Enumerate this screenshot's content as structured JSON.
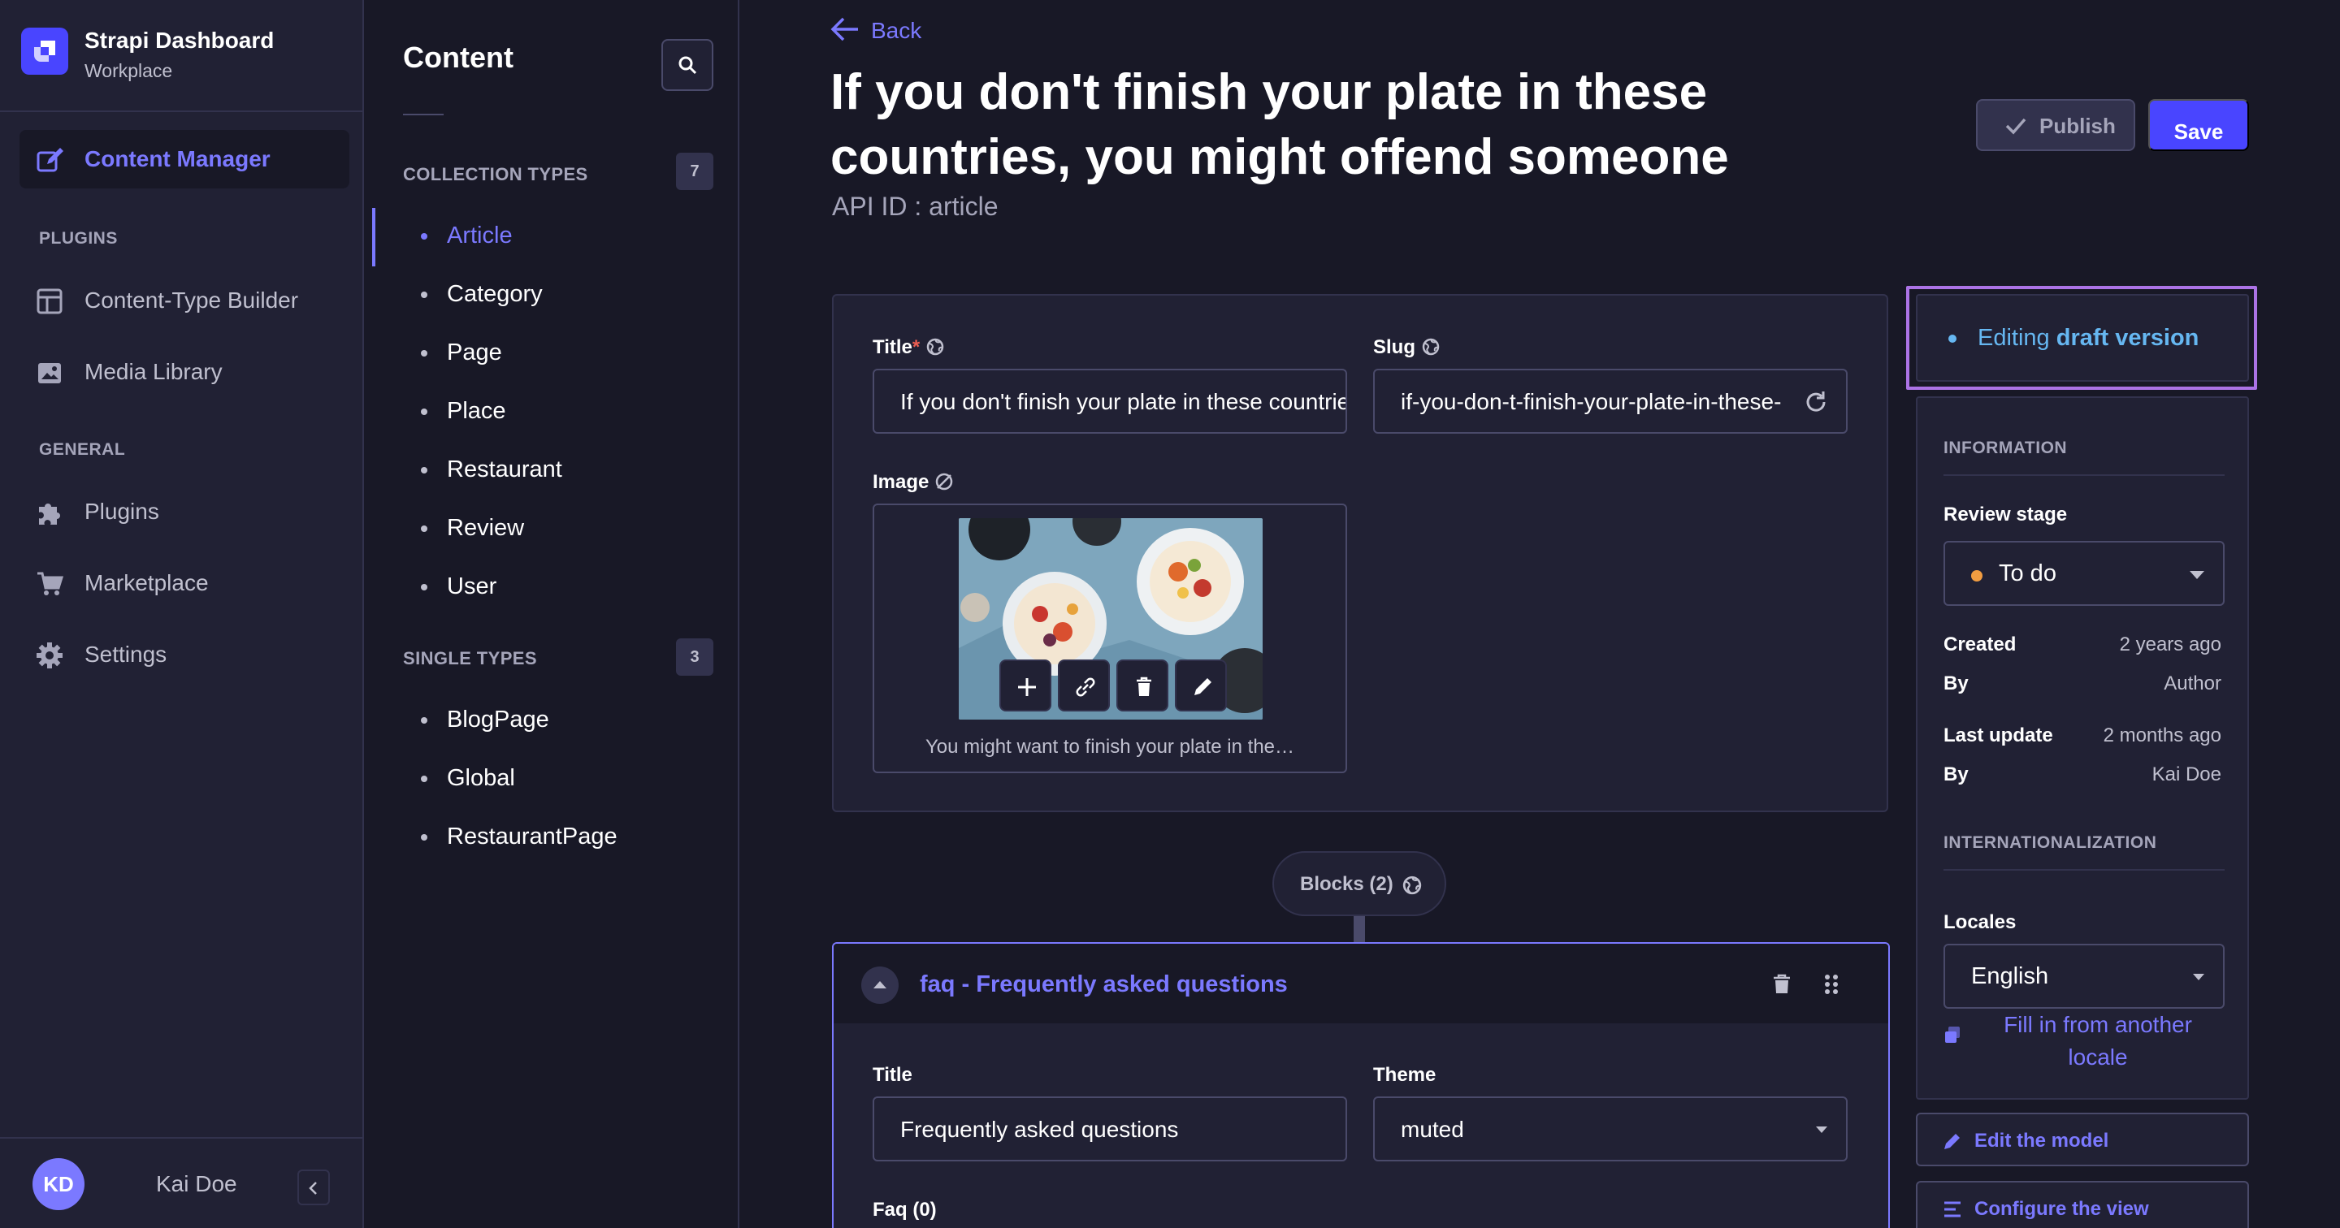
{
  "brand": {
    "title": "Strapi Dashboard",
    "subtitle": "Workplace"
  },
  "nav": {
    "content_manager": "Content Manager",
    "plugins_section": "PLUGINS",
    "plugins_items": [
      "Content-Type Builder",
      "Media Library"
    ],
    "general_section": "GENERAL",
    "general_items": [
      "Plugins",
      "Marketplace",
      "Settings"
    ],
    "user": {
      "initials": "KD",
      "name": "Kai Doe"
    }
  },
  "subnav": {
    "title": "Content",
    "collection_section": "COLLECTION TYPES",
    "collection_count": "7",
    "collection_items": [
      "Article",
      "Category",
      "Page",
      "Place",
      "Restaurant",
      "Review",
      "User"
    ],
    "active_item": "Article",
    "single_section": "SINGLE TYPES",
    "single_count": "3",
    "single_items": [
      "BlogPage",
      "Global",
      "RestaurantPage"
    ]
  },
  "header": {
    "back_label": "Back",
    "title": "If you don't finish your plate in these countries, you might offend someone",
    "api_id": "API ID : article",
    "publish_label": "Publish",
    "save_label": "Save"
  },
  "form": {
    "title_label": "Title",
    "title_required": "*",
    "title_value": "If you don't finish your plate in these countries, you might offend someone",
    "slug_label": "Slug",
    "slug_value": "if-you-don-t-finish-your-plate-in-these-countries-you-might-offend-someone",
    "image_label": "Image",
    "image_caption": "You might want to finish your plate in the…"
  },
  "blocks": {
    "pill_label": "Blocks (2)",
    "faq_title": "faq - Frequently asked questions",
    "faq_title_label": "Title",
    "faq_title_value": "Frequently asked questions",
    "theme_label": "Theme",
    "theme_value": "muted",
    "faq_list_label": "Faq (0)"
  },
  "panel": {
    "draft_prefix": "Editing ",
    "draft_bold": "draft version",
    "information": "INFORMATION",
    "review_stage_label": "Review stage",
    "review_stage_value": "To do",
    "created_label": "Created",
    "created_value": "2 years ago",
    "created_by_label": "By",
    "created_by_value": "Author",
    "updated_label": "Last update",
    "updated_value": "2 months ago",
    "updated_by_label": "By",
    "updated_by_value": "Kai Doe",
    "i18n": "INTERNATIONALIZATION",
    "locales_label": "Locales",
    "locale_value": "English",
    "fill_locale": "Fill in from another locale",
    "edit_model": "Edit the model",
    "configure_view": "Configure the view"
  },
  "colors": {
    "background": "#181826",
    "surface": "#212134",
    "accent": "#7b79ff",
    "primary_button": "#4945ff",
    "draft_info": "#66b7f1",
    "stage_dot": "#f29d41",
    "required": "#ee5e52",
    "focus_outline": "#ac73e6"
  },
  "icons": {
    "brand": "strapi-logo-icon",
    "search": "search-icon",
    "back": "arrow-left-icon",
    "publish": "check-icon",
    "i18n": "globe-icon",
    "slug_regen": "refresh-icon",
    "image_tools": [
      "plus-icon",
      "link-icon",
      "trash-icon",
      "pencil-icon"
    ]
  }
}
